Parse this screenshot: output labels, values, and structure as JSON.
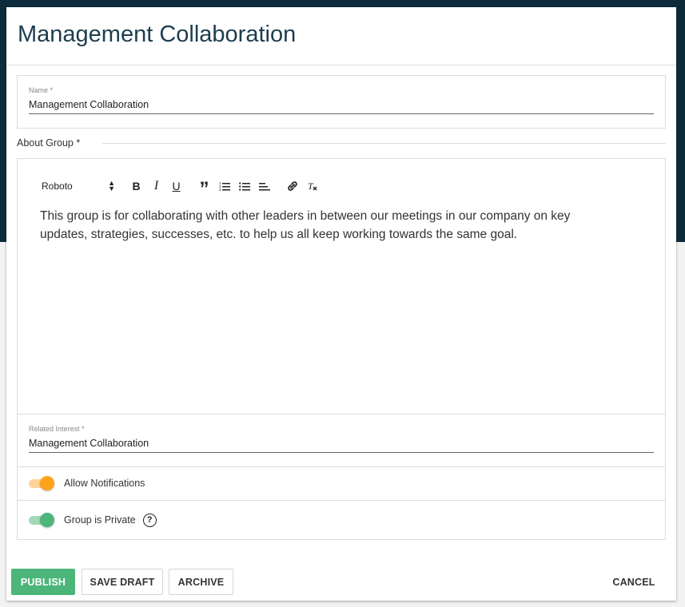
{
  "dialog": {
    "title": "Management Collaboration"
  },
  "name_field": {
    "label": "Name *",
    "value": "Management Collaboration"
  },
  "about": {
    "label": "About Group *"
  },
  "editor": {
    "font": "Roboto",
    "toolbar": {
      "bold": "B",
      "italic": "I",
      "underline": "U",
      "quote": "”"
    },
    "content": "This group is for collaborating with other leaders in between our meetings in our company on key updates, strategies, successes, etc. to help us all keep working towards the same goal."
  },
  "related_interest": {
    "label": "Related Interest *",
    "value": "Management Collaboration"
  },
  "notifications": {
    "label": "Allow Notifications",
    "on": true,
    "color": "#ffa31a",
    "track": "#ffd49a"
  },
  "private": {
    "label": "Group is Private",
    "on": true,
    "color": "#4cb67a",
    "track": "#a3d9b8",
    "help": "?"
  },
  "footer": {
    "publish": "PUBLISH",
    "save_draft": "SAVE DRAFT",
    "archive": "ARCHIVE",
    "cancel": "CANCEL",
    "publish_color": "#4cb67a"
  }
}
